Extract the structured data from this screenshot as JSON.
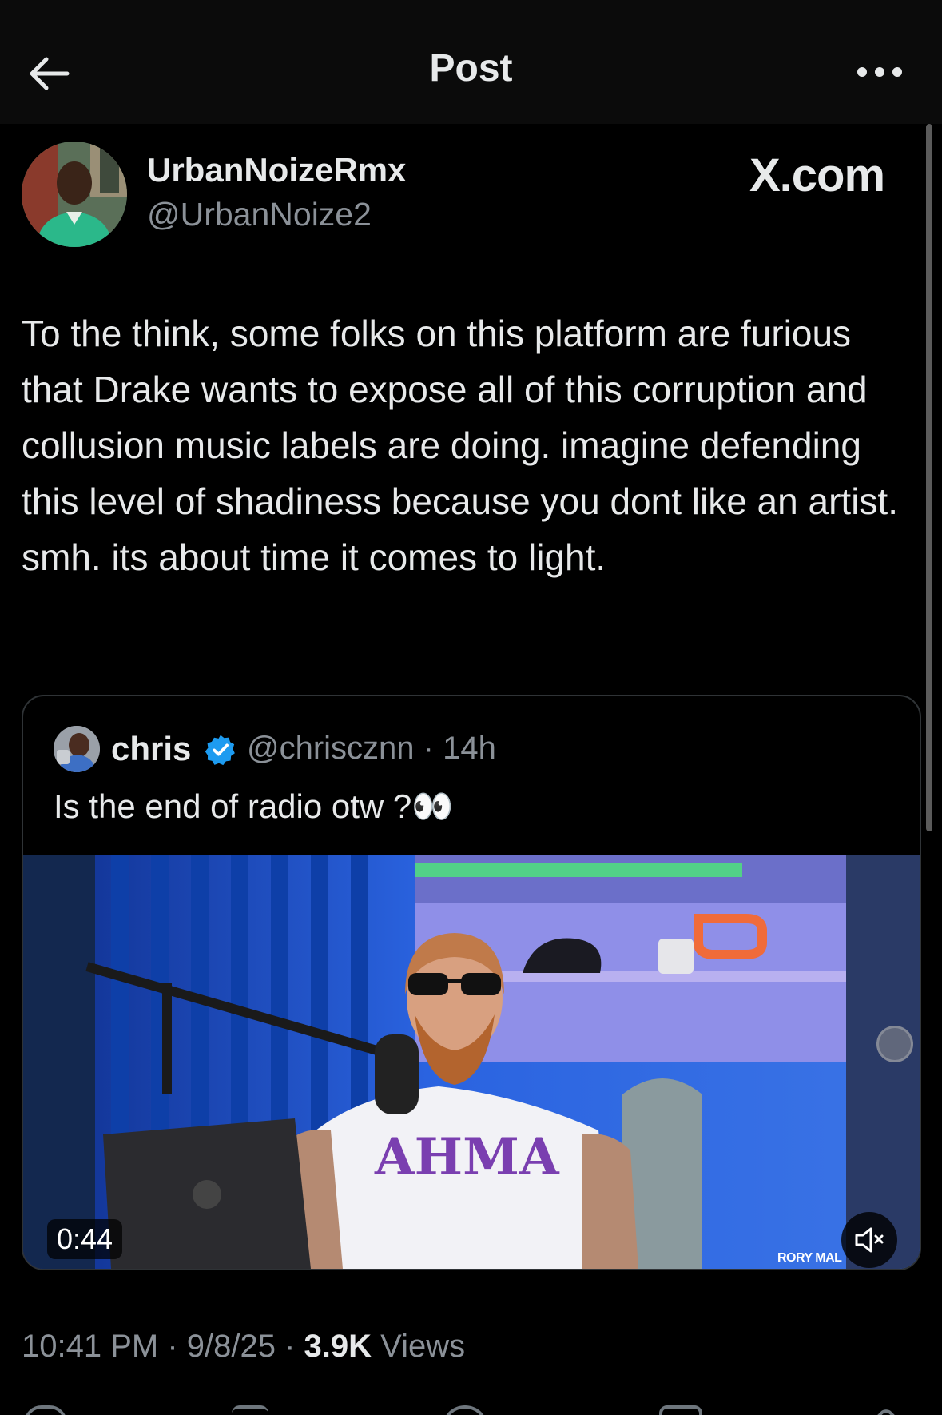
{
  "header": {
    "title": "Post",
    "back_icon": "arrow-left-icon",
    "more_icon": "more-horizontal-icon"
  },
  "post": {
    "author_name": "UrbanNoizeRmx",
    "author_handle": "@UrbanNoize2",
    "watermark": "X.com",
    "text": "To the think, some folks on this platform are furious that Drake wants to expose all of this corruption and collusion music labels are doing. imagine defending this level of shadiness because you dont like an artist. smh. its about time it comes to light.",
    "time": "10:41 PM",
    "date": "9/8/25",
    "views_count": "3.9K",
    "views_label": "Views"
  },
  "quote": {
    "name": "chris",
    "handle": "@chriscznn",
    "age": "14h",
    "text": "Is the end of radio otw ?👀",
    "verified_color": "#1d9bf0",
    "video": {
      "duration": "0:44",
      "credit": "RORY MAL",
      "mute_icon": "speaker-muted-icon"
    }
  },
  "colors": {
    "background": "#000000",
    "text_primary": "#e7e9ea",
    "text_secondary": "#8b9198",
    "border": "#2f3336"
  }
}
